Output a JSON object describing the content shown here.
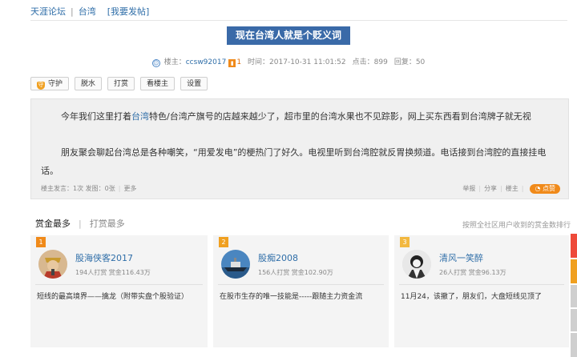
{
  "breadcrumb": {
    "forum": "天涯论坛",
    "sep": "|",
    "board": "台湾",
    "post_link": "[我要发帖]"
  },
  "post": {
    "title": "现在台湾人就是个贬义词",
    "meta": {
      "author_label": "楼主：",
      "author": "ccsw92017",
      "level": "1",
      "time": "时间：2017-10-31 11:01:52",
      "clicks": "点击：899",
      "replies": "回复：50"
    },
    "toolbar": {
      "guard": "守护",
      "remove_water": "脱水",
      "reward": "打赏",
      "view_op": "看楼主",
      "settings": "设置"
    },
    "paragraph1": {
      "before": "今年我们这里打着",
      "keyword": "台湾",
      "after": "特色/台湾产旗号的店越来越少了，超市里的台湾水果也不见踪影，网上买东西看到台湾牌子就无视"
    },
    "paragraph2": "朋友聚会聊起台湾总是各种嘲笑，“用爱发电”的梗热门了好久。电视里听到台湾腔就反胃换频道。电话接到台湾腔的直接挂电话。",
    "footer": {
      "stats": "楼主发言：1次 发图：0张",
      "more": "更多",
      "report": "举报",
      "share": "分享",
      "owner": "楼主",
      "like": "点赞"
    }
  },
  "ranking": {
    "tab_active": "赏金最多",
    "tab_sep": "|",
    "tab_other": "打赏最多",
    "note": "按照全社区用户收到的赏金数排行",
    "cards": [
      {
        "rank": "1",
        "badge_color": "#f08a1a",
        "name": "股海侠客2017",
        "stats": "194人打赏 赏金116.43万",
        "text": "短线的最高境界——擒龙（附带实盘个股验证）"
      },
      {
        "rank": "2",
        "badge_color": "#f0a020",
        "name": "股痴2008",
        "stats": "156人打赏 赏金102.90万",
        "text": "在股市生存的唯一技能是-----跟随主力资金流"
      },
      {
        "rank": "3",
        "badge_color": "#f2b840",
        "name": "清风一笑醉",
        "stats": "26人打赏 赏金96.13万",
        "text": "11月24，该撤了，朋友们，大盘短线见顶了"
      }
    ]
  },
  "colors": {
    "accent": "#3a6aa8",
    "link": "#2f6ea8",
    "orange": "#f08a1a"
  }
}
